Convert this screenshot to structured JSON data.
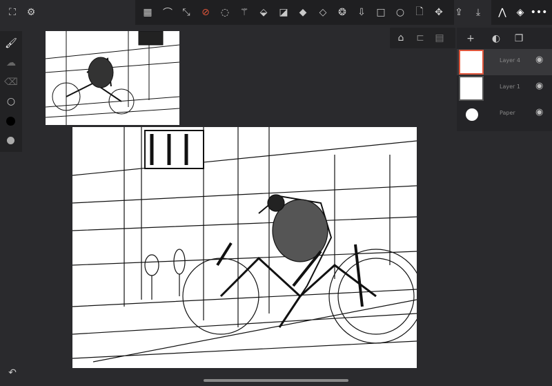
{
  "top_left": {
    "fullscreen_icon": "fullscreen-icon",
    "settings_icon": "gear-icon"
  },
  "toolbar": {
    "tools": [
      "perspective-grid",
      "curve",
      "transform",
      "compass",
      "lasso",
      "magic-wand",
      "fill",
      "gradient",
      "shape-fill",
      "symmetry",
      "spiral",
      "import",
      "rectangle",
      "ellipse",
      "page",
      "move",
      "share",
      "download"
    ],
    "active_tool": "compass",
    "accent": "#e0553a"
  },
  "top_right": {
    "tools": [
      "ruler",
      "layers",
      "more"
    ]
  },
  "sub_toolbar": {
    "tools": [
      "perspective",
      "snap",
      "grid-settings"
    ]
  },
  "layers_panel": {
    "actions": [
      "add",
      "blend",
      "duplicate"
    ],
    "layers": [
      {
        "name": "Layer 4",
        "selected": true
      },
      {
        "name": "Layer 1",
        "selected": false
      },
      {
        "name": "Paper",
        "selected": false
      }
    ]
  },
  "left_tools": [
    "brush",
    "smudge",
    "eraser",
    "brush-size",
    "color-black",
    "opacity"
  ],
  "bottom": {
    "undo_icon": "undo-icon"
  }
}
